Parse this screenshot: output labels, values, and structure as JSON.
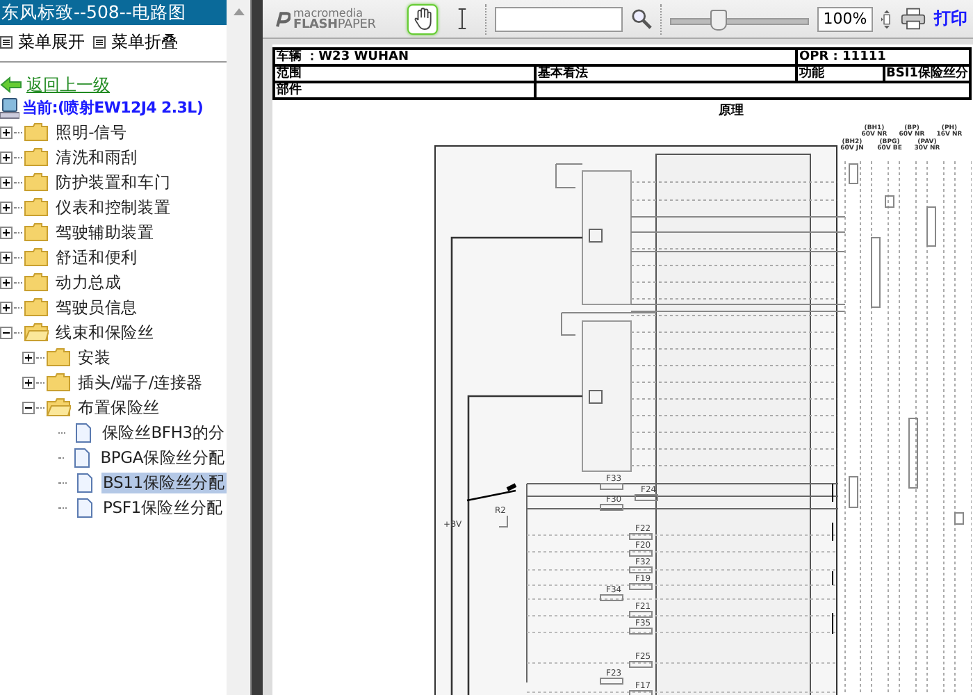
{
  "sidebar": {
    "title": "东风标致--508--电路图",
    "menu_buttons": [
      "菜单展开",
      "菜单折叠"
    ],
    "back_link": "返回上一级",
    "current": "当前:(喷射EW12J4 2.3L)",
    "tree": [
      {
        "label": "照明-信号",
        "kind": "folder",
        "expanded": false,
        "selected": false
      },
      {
        "label": "清洗和雨刮",
        "kind": "folder",
        "expanded": false,
        "selected": false
      },
      {
        "label": "防护装置和车门",
        "kind": "folder",
        "expanded": false,
        "selected": false
      },
      {
        "label": "仪表和控制装置",
        "kind": "folder",
        "expanded": false,
        "selected": false
      },
      {
        "label": "驾驶辅助装置",
        "kind": "folder",
        "expanded": false,
        "selected": false
      },
      {
        "label": "舒适和便利",
        "kind": "folder",
        "expanded": false,
        "selected": false
      },
      {
        "label": "动力总成",
        "kind": "folder",
        "expanded": false,
        "selected": false
      },
      {
        "label": "驾驶员信息",
        "kind": "folder",
        "expanded": false,
        "selected": false
      },
      {
        "label": "线束和保险丝",
        "kind": "folder",
        "expanded": true,
        "selected": false,
        "children": [
          {
            "label": "安装",
            "kind": "folder",
            "expanded": false,
            "selected": false
          },
          {
            "label": "插头/端子/连接器",
            "kind": "folder",
            "expanded": false,
            "selected": false
          },
          {
            "label": "布置保险丝",
            "kind": "folder",
            "expanded": true,
            "selected": false,
            "children": [
              {
                "label": "保险丝BFH3的分",
                "kind": "document",
                "selected": false
              },
              {
                "label": "BPGA保险丝分配",
                "kind": "document",
                "selected": false
              },
              {
                "label": "BS11保险丝分配",
                "kind": "document",
                "selected": true
              },
              {
                "label": "PSF1保险丝分配",
                "kind": "document",
                "selected": false
              }
            ]
          }
        ]
      }
    ]
  },
  "viewer": {
    "logo_top": "macromedia",
    "logo_bottom_bold": "FLASH",
    "logo_bottom": "PAPER",
    "tools": [
      {
        "kind": "hand",
        "selected": true
      },
      {
        "kind": "text",
        "selected": false
      }
    ],
    "zoom_slider": {
      "level": 0.34
    },
    "zoom_value": "100%",
    "print_label": "打印"
  },
  "document": {
    "header_rows": [
      [
        "车辆 ：W23 WUHAN",
        "OPR : 11111"
      ],
      [
        "范围",
        "基本看法",
        "功能",
        "BSI1保险丝分"
      ],
      [
        "部件"
      ]
    ],
    "section_title": "原理",
    "connector_labels": [
      {
        "text": "(BH1)\n60V NR"
      },
      {
        "text": "(BH2)\n60V JN"
      },
      {
        "text": "(BP)\n60V NR"
      },
      {
        "text": "(BPG)\n60V BE"
      },
      {
        "text": "(PH)\n16V NR"
      },
      {
        "text": "(PAV)\n30V NR"
      }
    ],
    "relay_switch": {
      "closed": false
    },
    "relay_label": "R2",
    "supply_label": "+BV",
    "fuses": [
      "F33",
      "F24",
      "F30",
      "F22",
      "F20",
      "F32",
      "F19",
      "F34",
      "F21",
      "F35",
      "F25",
      "F23",
      "F17"
    ]
  }
}
